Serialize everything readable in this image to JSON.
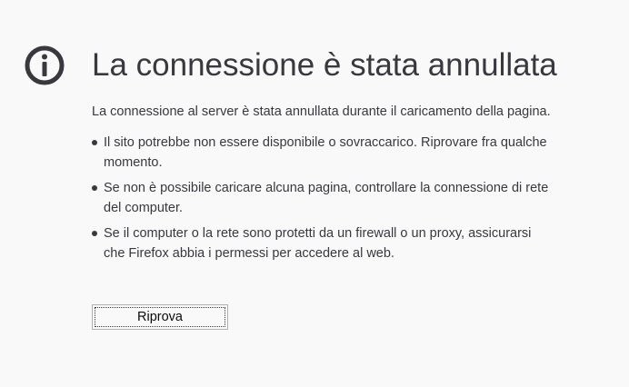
{
  "error": {
    "icon": "info-icon",
    "title": "La connessione è stata annullata",
    "description": "La connessione al server è stata annullata durante il caricamento della pagina.",
    "tips": [
      "Il sito potrebbe non essere disponibile o sovraccarico. Riprovare fra qualche momento.",
      "Se non è possibile caricare alcuna pagina, controllare la connessione di rete del computer.",
      "Se il computer o la rete sono protetti da un firewall o un proxy, assicurarsi che Firefox abbia i permessi per accedere al web."
    ],
    "retry_label": "Riprova"
  },
  "colors": {
    "background": "#f9f9fa",
    "text": "#38383d",
    "icon": "#38383d",
    "button_border": "#b1b1b3"
  }
}
